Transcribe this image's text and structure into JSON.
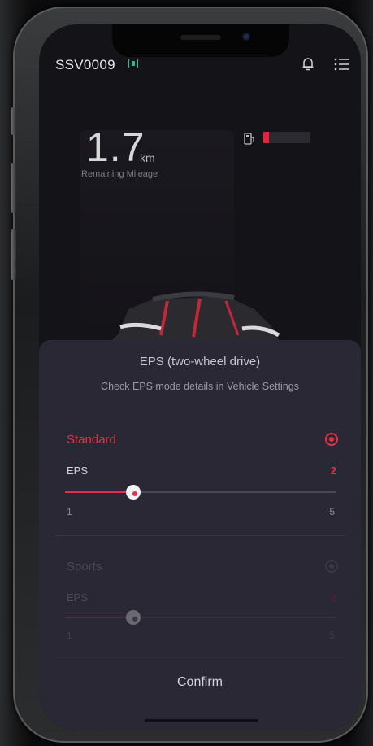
{
  "header": {
    "vehicle_id": "SSV0009",
    "battery_icon": "battery-icon",
    "bell_icon": "bell-icon",
    "menu_icon": "menu-icon"
  },
  "dashboard": {
    "mileage_value": "1.7",
    "mileage_unit": "km",
    "mileage_label": "Remaining Mileage",
    "fuel_icon": "fuel-pump-icon",
    "fuel_level_fraction": 0.12,
    "fuel_color": "#e0263e"
  },
  "sheet": {
    "title": "EPS (two-wheel drive)",
    "subtitle": "Check EPS mode details in Vehicle Settings",
    "modes": [
      {
        "label": "Standard",
        "selected": true,
        "param_label": "EPS",
        "value": "2",
        "min": "1",
        "max": "5"
      },
      {
        "label": "Sports",
        "selected": false,
        "param_label": "EPS",
        "value": "2",
        "min": "1",
        "max": "5"
      }
    ],
    "confirm_label": "Confirm"
  },
  "colors": {
    "accent": "#e1324a",
    "sheet_bg": "#2a2834",
    "screen_bg": "#141318"
  }
}
